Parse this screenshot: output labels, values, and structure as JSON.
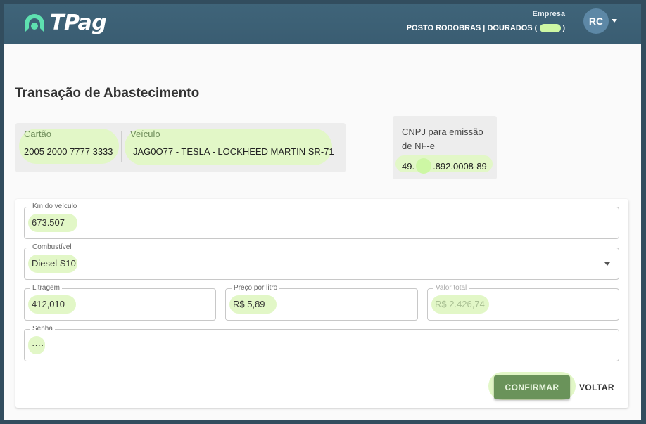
{
  "header": {
    "logo_text": "TPag",
    "company_label": "Empresa",
    "company_name": "POSTO RODOBRAS | DOURADOS (",
    "company_paren_close": ")",
    "avatar_initials": "RC"
  },
  "page": {
    "title": "Transação de Abastecimento"
  },
  "info": {
    "cartao_label": "Cartão",
    "cartao_value": "2005 2000 7777 3333",
    "veiculo_label": "Veículo",
    "veiculo_value": "JAG0O77 - TESLA - LOCKHEED MARTIN SR-71",
    "cnpj_label": "CNPJ para emissão de NF-e",
    "cnpj_prefix": "49.",
    "cnpj_suffix": ".892.0008-89"
  },
  "form": {
    "km_label": "Km do veículo",
    "km_value": "673.507",
    "combustivel_label": "Combustível",
    "combustivel_value": "Diesel S10",
    "litragem_label": "Litragem",
    "litragem_value": "412,010",
    "preco_label": "Preço por litro",
    "preco_value": "R$ 5,89",
    "valor_label": "Valor total",
    "valor_value": "R$ 2.426,74",
    "senha_label": "Senha",
    "senha_value": "····"
  },
  "actions": {
    "confirm_label": "CONFIRMAR",
    "back_label": "VOLTAR"
  },
  "colors": {
    "header_bg": "#3a5d72",
    "accent": "#5ee0b0",
    "highlight": "#e2f7c7",
    "confirm_bg": "#6a935a"
  },
  "icons": {
    "logo": "tpag-logo-icon",
    "select_caret": "chevron-down-icon",
    "avatar_caret": "chevron-down-icon"
  }
}
